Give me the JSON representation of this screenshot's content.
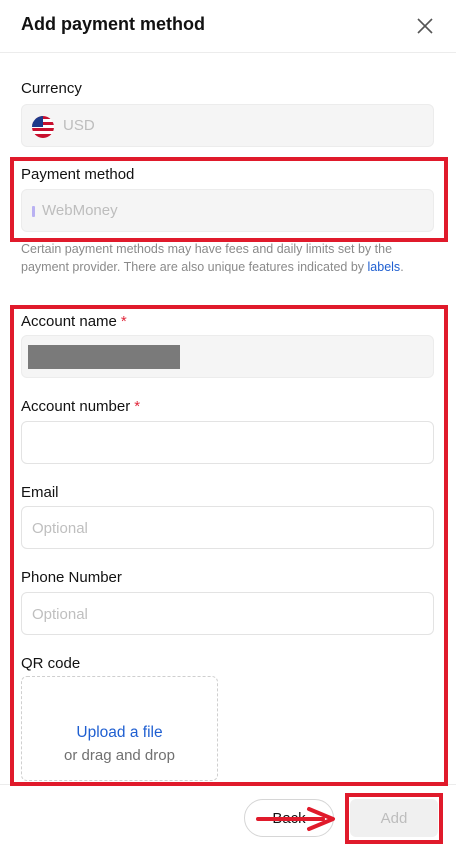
{
  "header": {
    "title": "Add payment method"
  },
  "currency": {
    "label": "Currency",
    "value": "USD"
  },
  "payment_method": {
    "label": "Payment method",
    "value": "WebMoney"
  },
  "note": {
    "text": "Certain payment methods may have fees and daily limits set by the payment provider. There are also unique features indicated by ",
    "link": "labels",
    "end": "."
  },
  "account_name": {
    "label": "Account name",
    "required": "*"
  },
  "account_number": {
    "label": "Account number",
    "required": "*"
  },
  "email": {
    "label": "Email",
    "placeholder": "Optional"
  },
  "phone": {
    "label": "Phone Number",
    "placeholder": "Optional"
  },
  "qr": {
    "label": "QR code",
    "upload_link": "Upload a file",
    "upload_sub": "or drag and drop"
  },
  "footer": {
    "back_label": "Back",
    "add_label": "Add"
  },
  "colors": {
    "highlight": "#e01a2b",
    "link": "#1f5fd1",
    "required": "#e0263a"
  }
}
